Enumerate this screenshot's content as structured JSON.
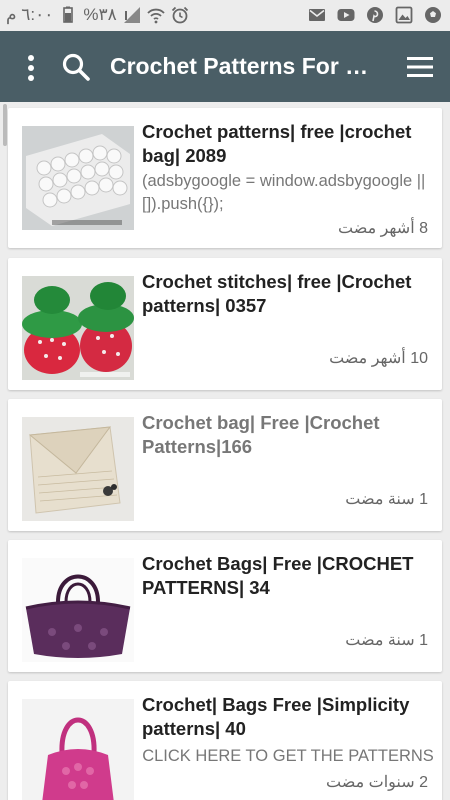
{
  "status_bar": {
    "time": "٦:٠٠ م",
    "battery_percent": "%٣٨",
    "left_icons": [
      "battery-icon",
      "signal-icon",
      "wifi-icon",
      "alarm-icon"
    ],
    "right_icons": [
      "email-icon",
      "youtube-icon",
      "pinterest-icon",
      "image-icon",
      "soccer-ball-icon"
    ]
  },
  "app_bar": {
    "title": "Crochet Patterns For Bags",
    "background": "#4a5e66",
    "icons": [
      "more-vertical-icon",
      "search-icon",
      "hamburger-menu-icon"
    ]
  },
  "posts": [
    {
      "title": "Crochet patterns| free |crochet bag| 2089",
      "description": "(adsbygoogle = window.adsbygoogle || []).push({});",
      "time_ago": "8 أشهر مضت",
      "thumbnail": "white-crochet-clutch-image"
    },
    {
      "title": "Crochet stitches| free |Crochet patterns| 0357",
      "description": "",
      "time_ago": "10 أشهر مضت",
      "thumbnail": "strawberry-crochet-bags-image"
    },
    {
      "title": "Crochet bag| Free |Crochet Patterns|166",
      "description": "",
      "time_ago": "1 سنة مضت",
      "thumbnail": "cream-lace-envelope-bag-image"
    },
    {
      "title": "Crochet Bags| Free |CROCHET PATTERNS| 34",
      "description": "",
      "time_ago": "1 سنة مضت",
      "thumbnail": "purple-crochet-handbag-image"
    },
    {
      "title": "Crochet| Bags Free |Simplicity patterns| 40",
      "description": "CLICK HERE TO GET THE PATTERNS",
      "time_ago": "2 سنوات مضت",
      "thumbnail": "pink-crochet-shoulder-bag-image"
    }
  ]
}
